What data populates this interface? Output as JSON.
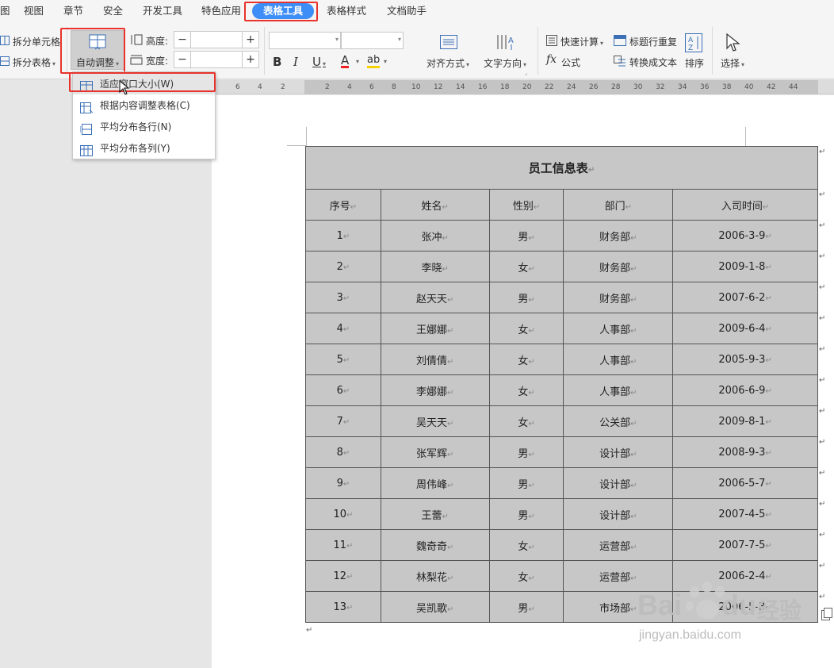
{
  "menu": {
    "partial_tab": "图",
    "tabs": [
      "视图",
      "章节",
      "安全",
      "开发工具",
      "特色应用",
      "表格工具",
      "表格样式",
      "文档助手"
    ],
    "active_tab": "表格工具"
  },
  "ribbon": {
    "split_cell": "拆分单元格",
    "split_table": "拆分表格",
    "auto_fit": "自动调整",
    "height_label": "高度:",
    "width_label": "宽度:",
    "height_value": "",
    "width_value": "",
    "bold": "B",
    "italic": "I",
    "underline": "U",
    "font_color": "A",
    "highlight": "ab",
    "align": "对齐方式",
    "text_direction": "文字方向",
    "quick_calc": "快速计算",
    "repeat_header": "标题行重复",
    "formula": "公式",
    "formula_fx": "fx",
    "to_text": "转换成文本",
    "sort": "排序",
    "select": "选择"
  },
  "dropdown": {
    "items": [
      "适应窗口大小(W)",
      "根据内容调整表格(C)",
      "平均分布各行(N)",
      "平均分布各列(Y)"
    ],
    "icons": [
      "fit-window-icon",
      "fit-content-icon",
      "distribute-rows-icon",
      "distribute-columns-icon"
    ]
  },
  "ruler": {
    "left_ticks": [
      "6",
      "4",
      "2"
    ],
    "right_ticks": [
      "2",
      "4",
      "6",
      "8",
      "10",
      "12",
      "14",
      "16",
      "18",
      "20",
      "22",
      "24",
      "26",
      "28",
      "30",
      "32",
      "34",
      "36",
      "38",
      "40",
      "42",
      "44"
    ]
  },
  "table": {
    "title": "员工信息表",
    "headers": [
      "序号",
      "姓名",
      "性别",
      "部门",
      "入司时间"
    ],
    "rows": [
      [
        "1",
        "张冲",
        "男",
        "财务部",
        "2006-3-9"
      ],
      [
        "2",
        "李晓",
        "女",
        "财务部",
        "2009-1-8"
      ],
      [
        "3",
        "赵天天",
        "男",
        "财务部",
        "2007-6-2"
      ],
      [
        "4",
        "王娜娜",
        "女",
        "人事部",
        "2009-6-4"
      ],
      [
        "5",
        "刘倩倩",
        "女",
        "人事部",
        "2005-9-3"
      ],
      [
        "6",
        "李娜娜",
        "女",
        "人事部",
        "2006-6-9"
      ],
      [
        "7",
        "吴天天",
        "女",
        "公关部",
        "2009-8-1"
      ],
      [
        "8",
        "张军辉",
        "男",
        "设计部",
        "2008-9-3"
      ],
      [
        "9",
        "周伟峰",
        "男",
        "设计部",
        "2006-5-7"
      ],
      [
        "10",
        "王蕾",
        "男",
        "设计部",
        "2007-4-5"
      ],
      [
        "11",
        "魏奇奇",
        "女",
        "运营部",
        "2007-7-5"
      ],
      [
        "12",
        "林梨花",
        "女",
        "运营部",
        "2006-2-4"
      ],
      [
        "13",
        "吴凯歌",
        "男",
        "市场部",
        "2006-5-3"
      ]
    ],
    "cell_mark": "↵",
    "row_end_mark": "↵"
  },
  "watermark": {
    "brand_left": "Bai",
    "brand_right": "du",
    "brand_cn": "经验",
    "url": "jingyan.baidu.com"
  },
  "colors": {
    "accent": "#3e8ef7",
    "highlight_border": "#e8322c",
    "table_fill": "#c7c7c7"
  }
}
